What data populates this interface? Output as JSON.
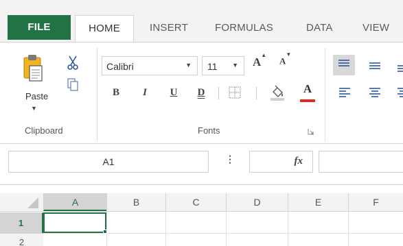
{
  "tabs": {
    "file": "FILE",
    "home": "HOME",
    "insert": "INSERT",
    "formulas": "FORMULAS",
    "data": "DATA",
    "view": "VIEW"
  },
  "ribbon": {
    "clipboard": {
      "group_label": "Clipboard",
      "paste_label": "Paste",
      "cut_icon": "scissors-icon",
      "copy_icon": "copy-icon"
    },
    "fonts": {
      "group_label": "Fonts",
      "font_name": "Calibri",
      "font_size": "11",
      "bold": "B",
      "italic": "I",
      "underline": "U",
      "double_underline": "D",
      "font_color_letter": "A",
      "grow_letter": "A",
      "shrink_letter": "A",
      "font_color": "#e02a1f"
    }
  },
  "formula_bar": {
    "name_box": "A1",
    "fx_label": "fx",
    "separator": "⋮"
  },
  "grid": {
    "columns": [
      "A",
      "B",
      "C",
      "D",
      "E",
      "F"
    ],
    "rows": [
      "1",
      "2"
    ],
    "active_cell": "A1"
  },
  "colors": {
    "accent": "#217346",
    "tab_bar": "#f3f3f3"
  }
}
